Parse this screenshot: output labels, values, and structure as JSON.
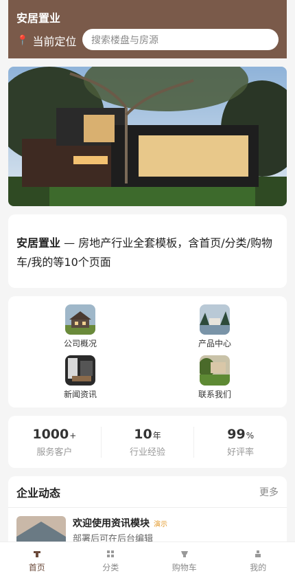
{
  "header": {
    "brand": "安居置业",
    "location_label": "当前定位",
    "search_placeholder": "搜索楼盘与房源"
  },
  "intro": {
    "brand": "安居置业",
    "text": " — 房地产行业全套模板，含首页/分类/购物车/我的等10个页面"
  },
  "grid": {
    "items": [
      {
        "label": "公司概况",
        "icon": "house-thumb"
      },
      {
        "label": "产品中心",
        "icon": "lake-house-thumb"
      },
      {
        "label": "新闻资讯",
        "icon": "interior-thumb"
      },
      {
        "label": "联系我们",
        "icon": "garden-house-thumb"
      }
    ]
  },
  "stats": [
    {
      "value": "1000",
      "unit": "+",
      "label": "服务客户"
    },
    {
      "value": "10",
      "unit": "年",
      "label": "行业经验"
    },
    {
      "value": "99",
      "unit": "%",
      "label": "好评率"
    }
  ],
  "news": {
    "title": "企业动态",
    "more": "更多",
    "items": [
      {
        "title": "欢迎使用资讯模块",
        "tag": "演示",
        "desc": "部署后可在后台编辑"
      }
    ]
  },
  "tabbar": {
    "items": [
      {
        "label": "首页",
        "icon": "home-icon",
        "active": true
      },
      {
        "label": "分类",
        "icon": "category-icon",
        "active": false
      },
      {
        "label": "购物车",
        "icon": "cart-icon",
        "active": false
      },
      {
        "label": "我的",
        "icon": "user-icon",
        "active": false
      }
    ]
  },
  "colors": {
    "brand": "#7a5a4a",
    "active_tab": "#6b4a3a",
    "tag": "#e39a2c"
  }
}
